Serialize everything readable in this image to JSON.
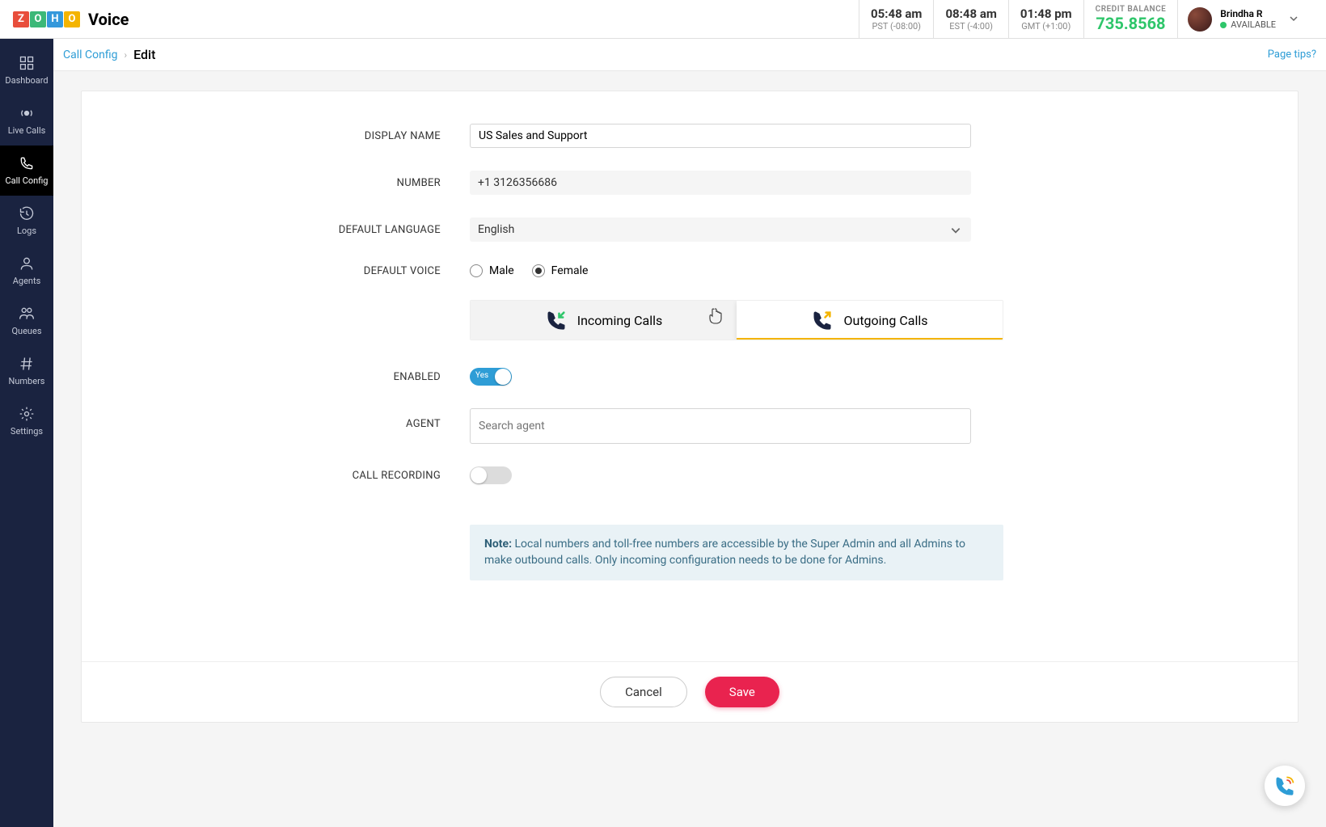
{
  "brand": {
    "name": "Voice",
    "tiles": [
      "Z",
      "O",
      "H",
      "O"
    ]
  },
  "clocks": [
    {
      "time": "05:48 am",
      "zone": "PST (-08:00)"
    },
    {
      "time": "08:48 am",
      "zone": "EST (-4:00)"
    },
    {
      "time": "01:48 pm",
      "zone": "GMT (+1:00)"
    }
  ],
  "credit": {
    "label": "CREDIT BALANCE",
    "value": "735.8568"
  },
  "user": {
    "name": "Brindha R",
    "status": "AVAILABLE"
  },
  "sidebar": [
    {
      "id": "dashboard",
      "label": "Dashboard"
    },
    {
      "id": "live-calls",
      "label": "Live Calls"
    },
    {
      "id": "call-config",
      "label": "Call Config"
    },
    {
      "id": "logs",
      "label": "Logs"
    },
    {
      "id": "agents",
      "label": "Agents"
    },
    {
      "id": "queues",
      "label": "Queues"
    },
    {
      "id": "numbers",
      "label": "Numbers"
    },
    {
      "id": "settings",
      "label": "Settings"
    }
  ],
  "breadcrumb": {
    "parent": "Call Config",
    "current": "Edit",
    "tips": "Page tips?"
  },
  "form": {
    "labels": {
      "display_name": "DISPLAY NAME",
      "number": "NUMBER",
      "default_language": "DEFAULT LANGUAGE",
      "default_voice": "DEFAULT VOICE",
      "enabled": "ENABLED",
      "agent": "AGENT",
      "call_recording": "CALL RECORDING"
    },
    "values": {
      "display_name": "US Sales and Support",
      "number": "+1 3126356686",
      "default_language": "English"
    },
    "voice_options": {
      "male": "Male",
      "female": "Female",
      "selected": "female"
    },
    "tabs": {
      "incoming": "Incoming Calls",
      "outgoing": "Outgoing Calls",
      "active": "outgoing"
    },
    "enabled_toggle": {
      "on": true,
      "text": "Yes"
    },
    "agent_placeholder": "Search agent",
    "call_recording_on": false
  },
  "note": {
    "prefix": "Note:",
    "text": "Local numbers and toll-free numbers are accessible by the Super Admin and all Admins to make outbound calls. Only incoming configuration needs to be done for Admins."
  },
  "footer": {
    "cancel": "Cancel",
    "save": "Save"
  }
}
